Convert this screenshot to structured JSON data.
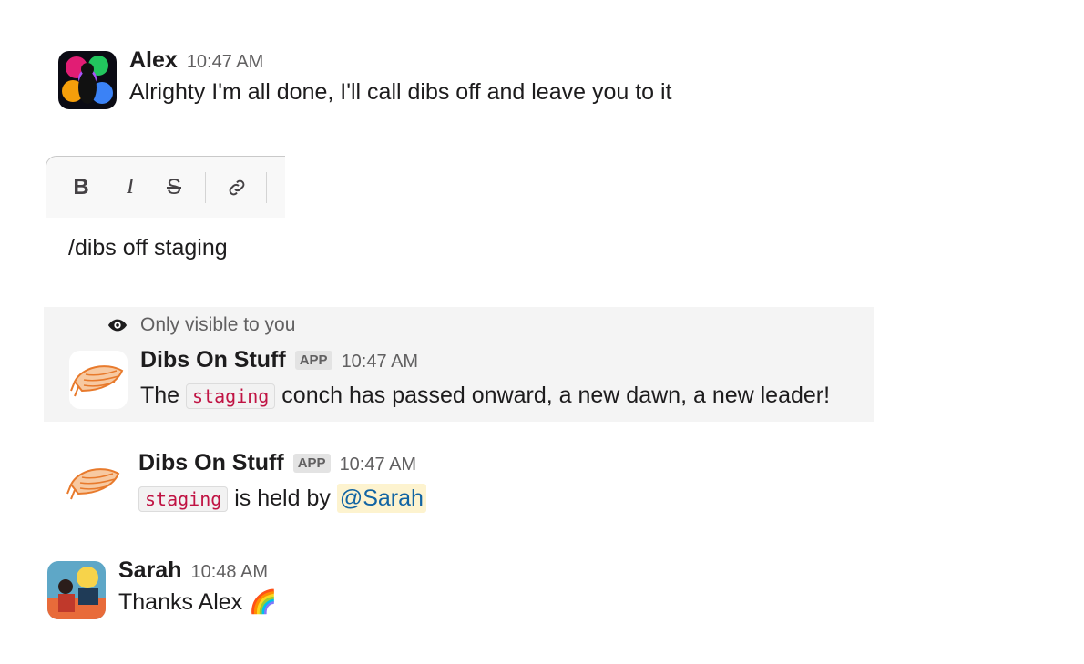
{
  "messages": {
    "alex": {
      "name": "Alex",
      "time": "10:47 AM",
      "text": "Alrighty I'm all done, I'll call dibs off and leave you to it"
    },
    "composer": {
      "bold_label": "B",
      "italic_label": "I",
      "strike_label": "S",
      "input_value": "/dibs off staging"
    },
    "ephemeral": {
      "note": "Only visible to you",
      "bot_name": "Dibs On Stuff",
      "badge": "APP",
      "time": "10:47 AM",
      "text_before": "The",
      "code": "staging",
      "text_after": "conch has passed onward, a new dawn, a new leader!"
    },
    "bot_public": {
      "bot_name": "Dibs On Stuff",
      "badge": "APP",
      "time": "10:47 AM",
      "code": "staging",
      "text_mid": "is held by",
      "mention": "@Sarah"
    },
    "sarah": {
      "name": "Sarah",
      "time": "10:48 AM",
      "text": "Thanks Alex",
      "emoji": "🌈"
    }
  },
  "colors": {
    "mention_text": "#1264a3",
    "mention_bg": "#fdf3cf",
    "code_text": "#c01343",
    "ephemeral_bg": "#f4f4f4"
  },
  "icons": [
    "eye-icon",
    "link-icon",
    "conch-shell-icon"
  ]
}
